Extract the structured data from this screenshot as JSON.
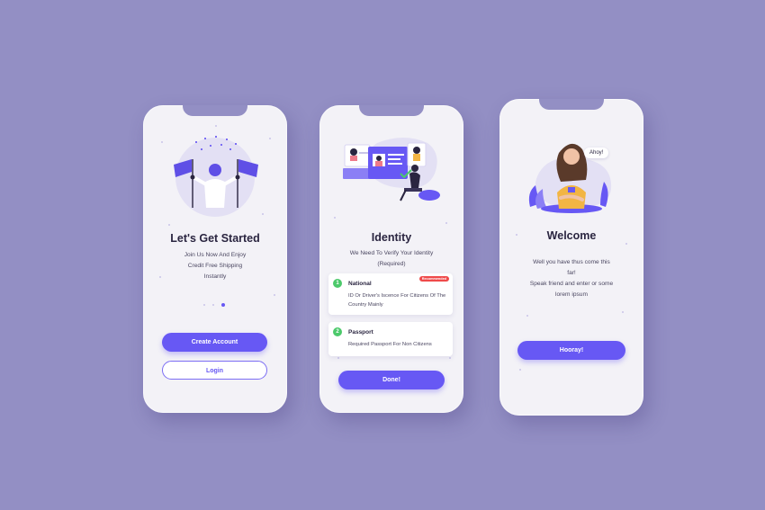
{
  "screens": {
    "start": {
      "title": "Let's Get Started",
      "subtitle_lines": [
        "Join Us Now And Enjoy",
        "Credit Free Shipping",
        "Instantly"
      ],
      "pagination": {
        "count": 3,
        "active_index": 2
      },
      "create_account_label": "Create Account",
      "login_label": "Login"
    },
    "identity": {
      "title": "Identity",
      "subtitle_lines": [
        "We Need To Verify Your Identity",
        "(Required)"
      ],
      "cards": [
        {
          "number": "1",
          "title": "National",
          "badge": "Recommended",
          "description": "ID Or Driver's Iscence For Citizens Of The Country Mainly"
        },
        {
          "number": "2",
          "title": "Passport",
          "description": "Required Passport For Non Citizens"
        }
      ],
      "done_label": "Done!"
    },
    "welcome": {
      "title": "Welcome",
      "speech_bubble": "Ahoy!",
      "body_lines": [
        "Well you have thus come this",
        "far!",
        "Speak friend and enter or some",
        "lorem ipsum"
      ],
      "hooray_label": "Hooray!"
    }
  },
  "colors": {
    "background": "#938fc4",
    "accent": "#6758f4",
    "success": "#4cc96b",
    "badge": "#ef4a4a"
  }
}
